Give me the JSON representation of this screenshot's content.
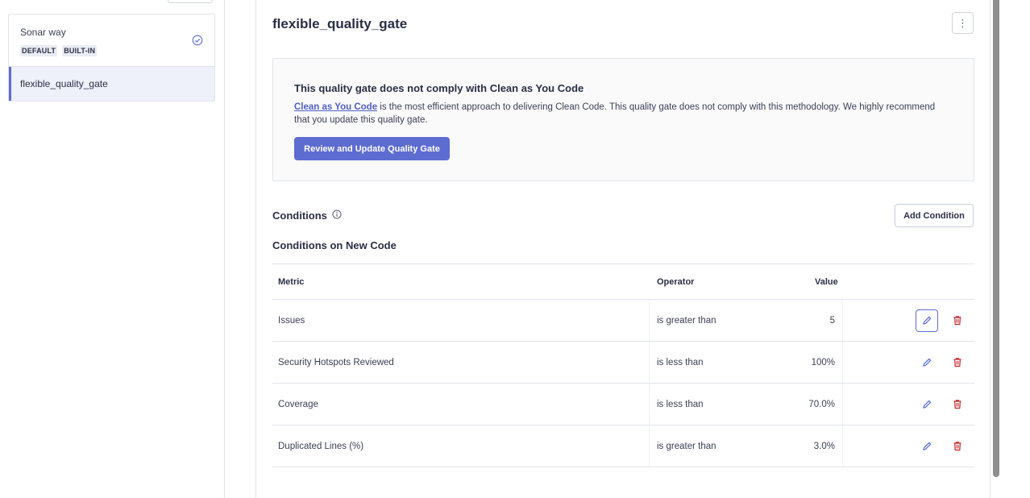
{
  "sidebar": {
    "gates": [
      {
        "name": "Sonar way",
        "badges": [
          "DEFAULT",
          "BUILT-IN"
        ],
        "icon": "check-circle-icon"
      },
      {
        "name": "flexible_quality_gate",
        "selected": true
      }
    ]
  },
  "main": {
    "title": "flexible_quality_gate",
    "more_icon": "⋮",
    "cayc": {
      "title": "This quality gate does not comply with Clean as You Code",
      "link": "Clean as You Code",
      "text": " is the most efficient approach to delivering Clean Code. This quality gate does not comply with this methodology. We highly recommend that you update this quality gate.",
      "button": "Review and Update Quality Gate"
    },
    "conditions": {
      "title": "Conditions",
      "add_button": "Add Condition",
      "subtitle": "Conditions on New Code",
      "headers": {
        "metric": "Metric",
        "operator": "Operator",
        "value": "Value"
      },
      "rows": [
        {
          "metric": "Issues",
          "operator": "is greater than",
          "value": "5"
        },
        {
          "metric": "Security Hotspots Reviewed",
          "operator": "is less than",
          "value": "100%"
        },
        {
          "metric": "Coverage",
          "operator": "is less than",
          "value": "70.0%"
        },
        {
          "metric": "Duplicated Lines (%)",
          "operator": "is greater than",
          "value": "3.0%"
        }
      ]
    }
  },
  "colors": {
    "accent": "#5d6cd0",
    "danger": "#c5262c",
    "link": "#4e5ec4"
  }
}
